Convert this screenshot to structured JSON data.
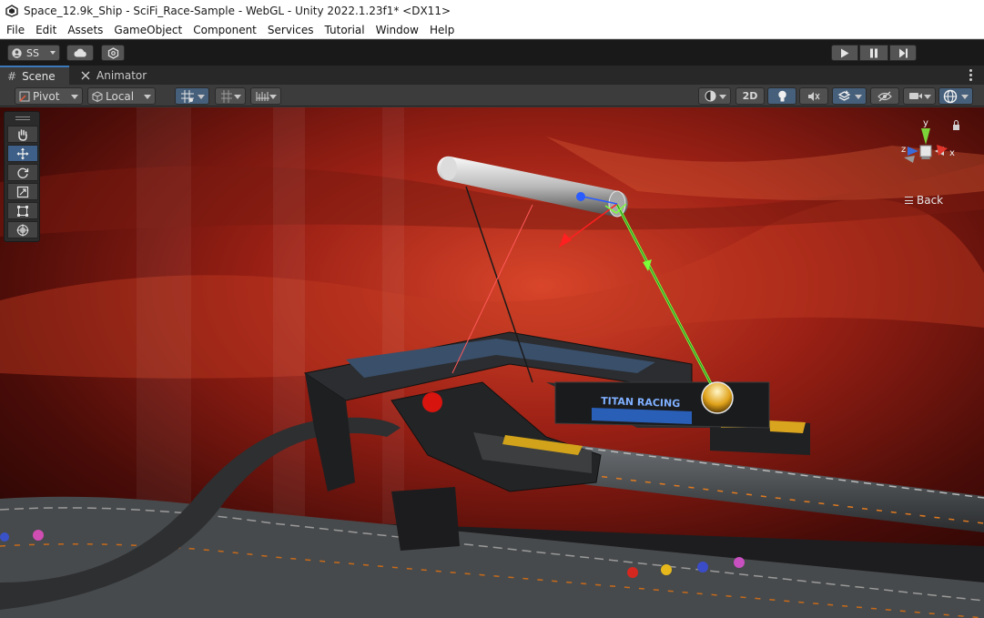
{
  "window": {
    "title": "Space_12.9k_Ship - SciFi_Race-Sample - WebGL - Unity 2022.1.23f1* <DX11>"
  },
  "menu": [
    "File",
    "Edit",
    "Assets",
    "GameObject",
    "Component",
    "Services",
    "Tutorial",
    "Window",
    "Help"
  ],
  "toolbar": {
    "account_label": "SS",
    "icons": [
      "account-icon",
      "cloud-icon",
      "collab-icon",
      "play-icon",
      "pause-icon",
      "step-icon"
    ]
  },
  "tabs": [
    {
      "label": "Scene",
      "icon": "grid-icon",
      "active": true
    },
    {
      "label": "Animator",
      "icon": "animator-icon",
      "active": false
    }
  ],
  "scene_toolbar": {
    "pivot_label": "Pivot",
    "local_label": "Local",
    "btn_2d_label": "2D"
  },
  "tools": [
    "hand-tool",
    "move-tool",
    "rotate-tool",
    "scale-tool",
    "rect-tool",
    "transform-tool"
  ],
  "active_tool": "move-tool",
  "gizmo": {
    "axis_y": "y",
    "axis_x": "x",
    "axis_z": "z",
    "back_label": "Back"
  },
  "scene": {
    "billboard_text": "TITAN RACING",
    "colors": {
      "sky_red": "#b3261a",
      "sky_dark": "#2a0806",
      "selection_green": "#7cff3a",
      "handle_red": "#ff2020",
      "handle_blue": "#2a5cff"
    }
  },
  "accent": "#3a79bb"
}
